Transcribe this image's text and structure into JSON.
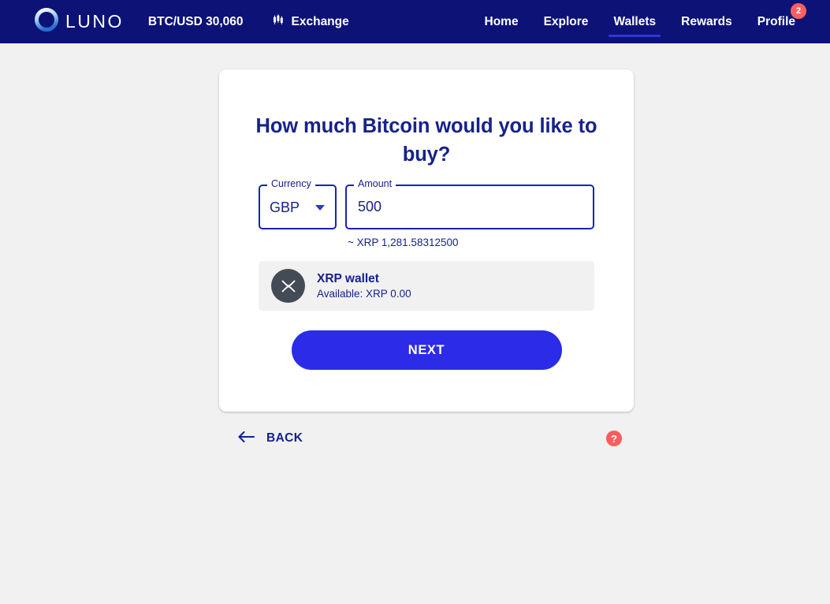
{
  "navbar": {
    "brand": {
      "logo_icon": "luno-ring-logo",
      "wordmark": "LUNO"
    },
    "ticker": "BTC/USD 30,060",
    "exchange": {
      "label": "Exchange",
      "icon": "candlestick-chart-icon"
    },
    "menu": [
      {
        "label": "Home",
        "active": false
      },
      {
        "label": "Explore",
        "active": false
      },
      {
        "label": "Wallets",
        "active": true
      },
      {
        "label": "Rewards",
        "active": false
      },
      {
        "label": "Profile",
        "active": false,
        "badge": "2"
      }
    ],
    "colors": {
      "background": "#0d1277",
      "text": "#ffffff",
      "active_underline": "#3333dd",
      "badge": "#ff5f5f"
    }
  },
  "card": {
    "title": "How much Bitcoin would you like to buy?",
    "currency_field": {
      "label": "Currency",
      "value": "GBP",
      "caret_icon": "chevron-down-icon"
    },
    "amount_field": {
      "label": "Amount",
      "value": "500",
      "placeholder": ""
    },
    "conversion_text": "~ XRP 1,281.58312500",
    "wallet": {
      "icon": "xrp-coin-icon",
      "name": "XRP wallet",
      "available": "Available: XRP 0.00"
    },
    "next_button": "NEXT"
  },
  "footer": {
    "back": {
      "label": "BACK",
      "icon": "arrow-left-icon"
    },
    "help": {
      "label": "?",
      "icon": "question-mark-icon"
    }
  },
  "theme": {
    "page_background": "#f1f1f1",
    "card_background": "#ffffff",
    "primary_blue": "#2b2be8",
    "navy_text": "#16228c",
    "field_border": "#1a22b8",
    "wallet_icon_bg": "#434b57",
    "help_red": "#fd5c5c"
  }
}
